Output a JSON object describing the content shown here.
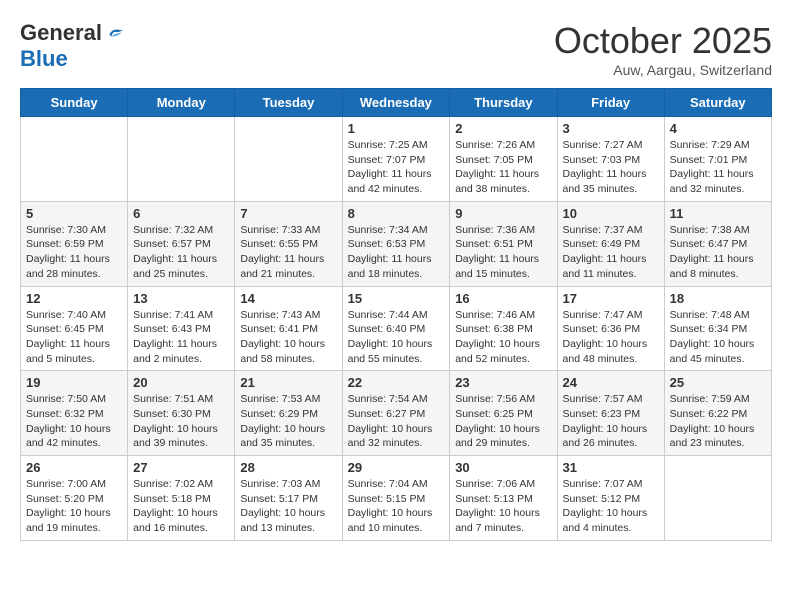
{
  "logo": {
    "general": "General",
    "blue": "Blue"
  },
  "title": "October 2025",
  "location": "Auw, Aargau, Switzerland",
  "days_of_week": [
    "Sunday",
    "Monday",
    "Tuesday",
    "Wednesday",
    "Thursday",
    "Friday",
    "Saturday"
  ],
  "weeks": [
    [
      {
        "day": "",
        "info": ""
      },
      {
        "day": "",
        "info": ""
      },
      {
        "day": "",
        "info": ""
      },
      {
        "day": "1",
        "info": "Sunrise: 7:25 AM\nSunset: 7:07 PM\nDaylight: 11 hours and 42 minutes."
      },
      {
        "day": "2",
        "info": "Sunrise: 7:26 AM\nSunset: 7:05 PM\nDaylight: 11 hours and 38 minutes."
      },
      {
        "day": "3",
        "info": "Sunrise: 7:27 AM\nSunset: 7:03 PM\nDaylight: 11 hours and 35 minutes."
      },
      {
        "day": "4",
        "info": "Sunrise: 7:29 AM\nSunset: 7:01 PM\nDaylight: 11 hours and 32 minutes."
      }
    ],
    [
      {
        "day": "5",
        "info": "Sunrise: 7:30 AM\nSunset: 6:59 PM\nDaylight: 11 hours and 28 minutes."
      },
      {
        "day": "6",
        "info": "Sunrise: 7:32 AM\nSunset: 6:57 PM\nDaylight: 11 hours and 25 minutes."
      },
      {
        "day": "7",
        "info": "Sunrise: 7:33 AM\nSunset: 6:55 PM\nDaylight: 11 hours and 21 minutes."
      },
      {
        "day": "8",
        "info": "Sunrise: 7:34 AM\nSunset: 6:53 PM\nDaylight: 11 hours and 18 minutes."
      },
      {
        "day": "9",
        "info": "Sunrise: 7:36 AM\nSunset: 6:51 PM\nDaylight: 11 hours and 15 minutes."
      },
      {
        "day": "10",
        "info": "Sunrise: 7:37 AM\nSunset: 6:49 PM\nDaylight: 11 hours and 11 minutes."
      },
      {
        "day": "11",
        "info": "Sunrise: 7:38 AM\nSunset: 6:47 PM\nDaylight: 11 hours and 8 minutes."
      }
    ],
    [
      {
        "day": "12",
        "info": "Sunrise: 7:40 AM\nSunset: 6:45 PM\nDaylight: 11 hours and 5 minutes."
      },
      {
        "day": "13",
        "info": "Sunrise: 7:41 AM\nSunset: 6:43 PM\nDaylight: 11 hours and 2 minutes."
      },
      {
        "day": "14",
        "info": "Sunrise: 7:43 AM\nSunset: 6:41 PM\nDaylight: 10 hours and 58 minutes."
      },
      {
        "day": "15",
        "info": "Sunrise: 7:44 AM\nSunset: 6:40 PM\nDaylight: 10 hours and 55 minutes."
      },
      {
        "day": "16",
        "info": "Sunrise: 7:46 AM\nSunset: 6:38 PM\nDaylight: 10 hours and 52 minutes."
      },
      {
        "day": "17",
        "info": "Sunrise: 7:47 AM\nSunset: 6:36 PM\nDaylight: 10 hours and 48 minutes."
      },
      {
        "day": "18",
        "info": "Sunrise: 7:48 AM\nSunset: 6:34 PM\nDaylight: 10 hours and 45 minutes."
      }
    ],
    [
      {
        "day": "19",
        "info": "Sunrise: 7:50 AM\nSunset: 6:32 PM\nDaylight: 10 hours and 42 minutes."
      },
      {
        "day": "20",
        "info": "Sunrise: 7:51 AM\nSunset: 6:30 PM\nDaylight: 10 hours and 39 minutes."
      },
      {
        "day": "21",
        "info": "Sunrise: 7:53 AM\nSunset: 6:29 PM\nDaylight: 10 hours and 35 minutes."
      },
      {
        "day": "22",
        "info": "Sunrise: 7:54 AM\nSunset: 6:27 PM\nDaylight: 10 hours and 32 minutes."
      },
      {
        "day": "23",
        "info": "Sunrise: 7:56 AM\nSunset: 6:25 PM\nDaylight: 10 hours and 29 minutes."
      },
      {
        "day": "24",
        "info": "Sunrise: 7:57 AM\nSunset: 6:23 PM\nDaylight: 10 hours and 26 minutes."
      },
      {
        "day": "25",
        "info": "Sunrise: 7:59 AM\nSunset: 6:22 PM\nDaylight: 10 hours and 23 minutes."
      }
    ],
    [
      {
        "day": "26",
        "info": "Sunrise: 7:00 AM\nSunset: 5:20 PM\nDaylight: 10 hours and 19 minutes."
      },
      {
        "day": "27",
        "info": "Sunrise: 7:02 AM\nSunset: 5:18 PM\nDaylight: 10 hours and 16 minutes."
      },
      {
        "day": "28",
        "info": "Sunrise: 7:03 AM\nSunset: 5:17 PM\nDaylight: 10 hours and 13 minutes."
      },
      {
        "day": "29",
        "info": "Sunrise: 7:04 AM\nSunset: 5:15 PM\nDaylight: 10 hours and 10 minutes."
      },
      {
        "day": "30",
        "info": "Sunrise: 7:06 AM\nSunset: 5:13 PM\nDaylight: 10 hours and 7 minutes."
      },
      {
        "day": "31",
        "info": "Sunrise: 7:07 AM\nSunset: 5:12 PM\nDaylight: 10 hours and 4 minutes."
      },
      {
        "day": "",
        "info": ""
      }
    ]
  ]
}
